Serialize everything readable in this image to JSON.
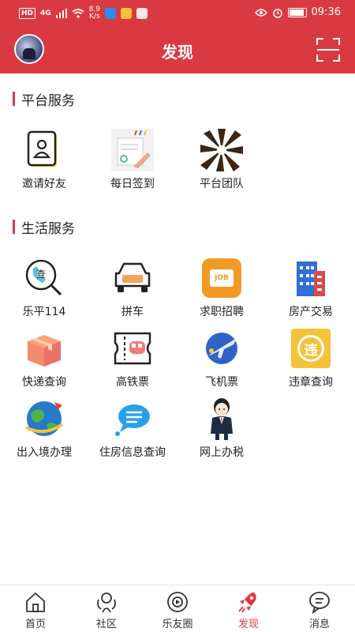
{
  "status_bar": {
    "hd": "HD",
    "network": "4G",
    "speed_value": "8.9",
    "speed_unit": "K/s",
    "time": "09:36"
  },
  "header": {
    "title": "发现"
  },
  "sections": [
    {
      "title": "平台服务",
      "items": [
        {
          "label": "邀请好友",
          "icon": "invite-icon"
        },
        {
          "label": "每日签到",
          "icon": "sign-in-icon"
        },
        {
          "label": "平台团队",
          "icon": "team-icon"
        }
      ]
    },
    {
      "title": "生活服务",
      "items": [
        {
          "label": "乐平114",
          "icon": "phone-search-icon"
        },
        {
          "label": "拼车",
          "icon": "car-icon"
        },
        {
          "label": "求职招聘",
          "icon": "job-icon"
        },
        {
          "label": "房产交易",
          "icon": "building-icon"
        },
        {
          "label": "快递查询",
          "icon": "package-icon"
        },
        {
          "label": "高铁票",
          "icon": "train-ticket-icon"
        },
        {
          "label": "飞机票",
          "icon": "airplane-icon"
        },
        {
          "label": "违章查询",
          "icon": "violation-icon"
        },
        {
          "label": "出入境办理",
          "icon": "globe-icon"
        },
        {
          "label": "住房信息查询",
          "icon": "chat-bubble-icon"
        },
        {
          "label": "网上办税",
          "icon": "tax-clerk-icon"
        }
      ]
    }
  ],
  "job_badge": "JOB",
  "violation_char": "违",
  "bottom_nav": [
    {
      "label": "首页",
      "icon": "home-icon",
      "active": false
    },
    {
      "label": "社区",
      "icon": "community-icon",
      "active": false
    },
    {
      "label": "乐友圈",
      "icon": "circle-icon",
      "active": false
    },
    {
      "label": "发现",
      "icon": "rocket-icon",
      "active": true
    },
    {
      "label": "消息",
      "icon": "message-icon",
      "active": false
    }
  ],
  "colors": {
    "brand_red": "#d93a42",
    "text": "#222222"
  }
}
